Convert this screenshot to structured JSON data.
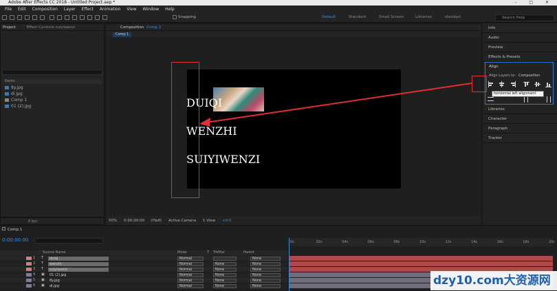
{
  "title": "Adobe After Effects CC 2018 - Untitled Project.aep *",
  "menu": [
    "File",
    "Edit",
    "Composition",
    "Layer",
    "Effect",
    "Animation",
    "View",
    "Window",
    "Help"
  ],
  "toolbar": {
    "snapping": "Snapping",
    "workspaces": [
      "Default",
      "Standard",
      "Small Screen",
      "Libraries",
      "standart"
    ],
    "search_placeholder": "Search Help"
  },
  "project": {
    "tab": "Project",
    "effects_tab": "Effect Controls suiyiwenzi",
    "col_name": "Name",
    "items": [
      {
        "name": "8y.jpg",
        "type": "image"
      },
      {
        "name": "di.jpg",
        "type": "image"
      },
      {
        "name": "Comp 1",
        "type": "comp"
      },
      {
        "name": "01 (2).jpg",
        "type": "image"
      }
    ],
    "bpc": "8 bpc"
  },
  "composition": {
    "tab": "Composition",
    "name": "Comp 1",
    "subtab": "Comp 1",
    "lines": [
      "DUIQI",
      "WENZHI",
      "SUIYIWENZI"
    ],
    "controls": {
      "zoom": "50%",
      "time": "0:00:00:00",
      "resolution": "(Half)",
      "camera": "Active Camera",
      "view": "1 View",
      "offset": "+0.0"
    }
  },
  "right_panels": {
    "info": "Info",
    "audio": "Audio",
    "preview": "Preview",
    "effects": "Effects & Presets",
    "align": "Align",
    "align_to_label": "Align Layers to:",
    "align_to_value": "Composition",
    "tooltip": "horizontal left alignment",
    "libraries": "Libraries",
    "character": "Character",
    "paragraph": "Paragraph",
    "tracker": "Tracker"
  },
  "timeline": {
    "tab": "Comp 1",
    "time": "0:00:00:00",
    "columns": {
      "source": "Source Name",
      "mode": "Mode",
      "t": "T",
      "trkmat": "TrkMat",
      "parent": "Parent"
    },
    "ruler": [
      "0s",
      "02s",
      "04s",
      "06s",
      "08s",
      "10s",
      "12s",
      "14s",
      "16s",
      "18s",
      "20s"
    ],
    "layers": [
      {
        "num": "1",
        "type": "T",
        "name": "duiqi",
        "mode": "Normal",
        "trk": "",
        "parent": "None",
        "color": "#b04a4a",
        "label": "#c98080"
      },
      {
        "num": "2",
        "type": "T",
        "name": "wenzhi",
        "mode": "Normal",
        "trk": "None",
        "parent": "None",
        "color": "#b04a4a",
        "label": "#c98080"
      },
      {
        "num": "3",
        "type": "T",
        "name": "suiyiwenzi",
        "mode": "Normal",
        "trk": "None",
        "parent": "None",
        "color": "#b04a4a",
        "label": "#c98080"
      },
      {
        "num": "4",
        "type": "img",
        "name": "01 (2).jpg",
        "mode": "Normal",
        "trk": "None",
        "parent": "None",
        "color": "#6d6d7e",
        "label": "#7e7e9a"
      },
      {
        "num": "5",
        "type": "img",
        "name": "8y.jpg",
        "mode": "Normal",
        "trk": "None",
        "parent": "None",
        "color": "#6d6d7e",
        "label": "#7e7e9a"
      },
      {
        "num": "6",
        "type": "img",
        "name": "di.jpg",
        "mode": "Normal",
        "trk": "None",
        "parent": "None",
        "color": "#6d6d7e",
        "label": "#7e7e9a"
      }
    ]
  },
  "watermark": "dzy10.com大资源网",
  "colors": {
    "accent": "#3b8ede",
    "highlight": "#e03030"
  }
}
